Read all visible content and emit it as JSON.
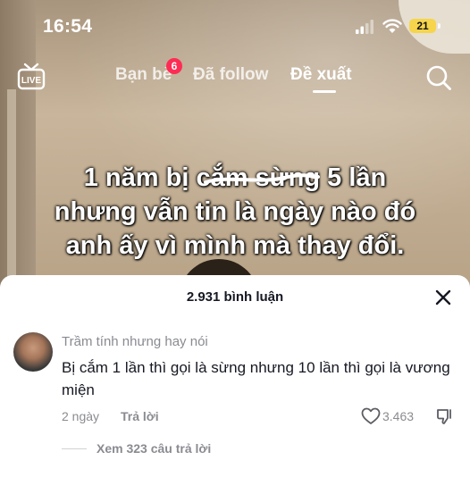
{
  "status_bar": {
    "time": "16:54",
    "battery": "21"
  },
  "top_nav": {
    "live_label": "LIVE",
    "tabs": [
      {
        "label": "Bạn bè",
        "badge": "6"
      },
      {
        "label": "Đã follow"
      },
      {
        "label": "Đề xuất",
        "active": true
      }
    ]
  },
  "video": {
    "caption_lines": [
      "1 năm bị cắm sừng 5 lần",
      "nhưng vẫn tin là ngày nào đó",
      "anh ấy vì mình mà thay đổi."
    ]
  },
  "comments_sheet": {
    "count_label": "2.931 bình luận",
    "comment": {
      "username": "Trầm tính nhưng hay nói",
      "text": "Bị cắm 1 lần thì gọi là sừng nhưng 10 lần thì gọi là vương miện",
      "age": "2 ngày",
      "reply_label": "Trả lời",
      "likes": "3.463"
    },
    "view_replies_label": "Xem 323 câu trả lời"
  },
  "colors": {
    "badge": "#fe2c55",
    "battery": "#f6d54c",
    "accent": "#fe2c55"
  },
  "icons": [
    "live-icon",
    "search-icon",
    "close-icon",
    "heart-icon",
    "dislike-icon",
    "wifi-icon",
    "signal-icon"
  ]
}
